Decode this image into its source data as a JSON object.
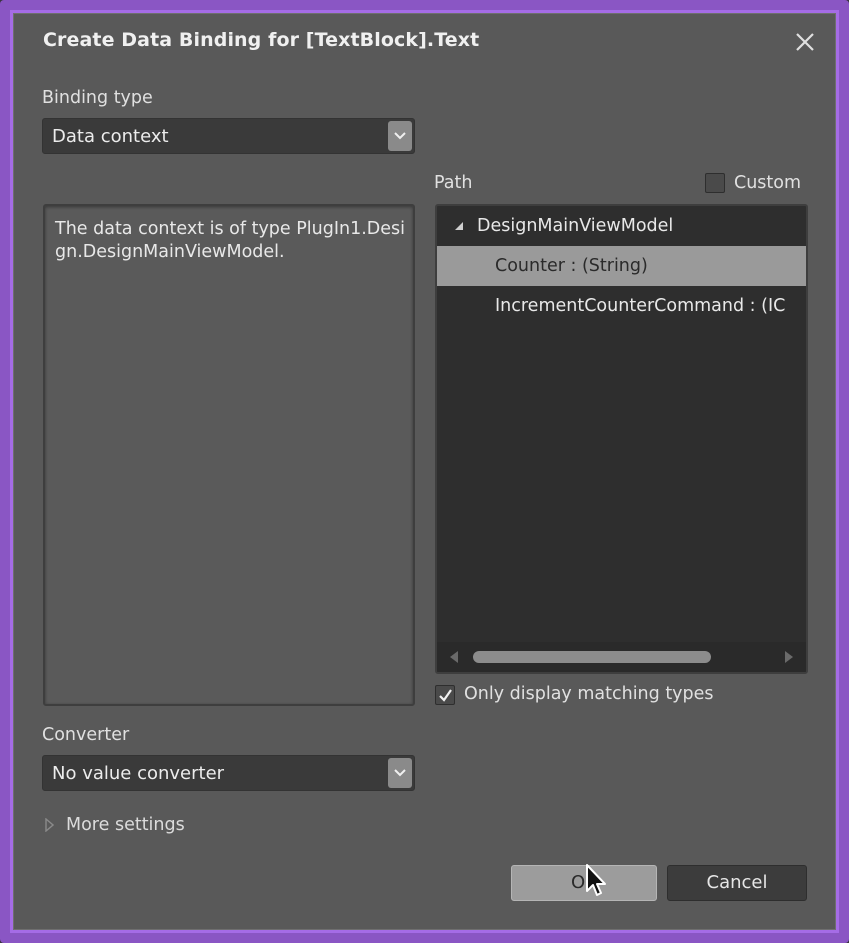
{
  "dialog": {
    "title": "Create Data Binding for [TextBlock].Text"
  },
  "binding_type": {
    "label": "Binding type",
    "selected": "Data context"
  },
  "description": "The data context is of type PlugIn1.Design.DesignMainViewModel.",
  "path": {
    "label": "Path",
    "custom_label": "Custom",
    "custom_checked": false,
    "tree": {
      "root": "DesignMainViewModel",
      "items": [
        {
          "label": "Counter : (String)",
          "selected": true
        },
        {
          "label": "IncrementCounterCommand : (IC",
          "selected": false
        }
      ]
    },
    "only_matching_label": "Only display matching types",
    "only_matching_checked": true
  },
  "converter": {
    "label": "Converter",
    "selected": "No value converter"
  },
  "more_settings": "More settings",
  "buttons": {
    "ok": "OK",
    "cancel": "Cancel"
  },
  "colors": {
    "frame_accent": "#a56ce6",
    "dialog_bg": "#595959",
    "selected_row": "#9a9a9a"
  }
}
